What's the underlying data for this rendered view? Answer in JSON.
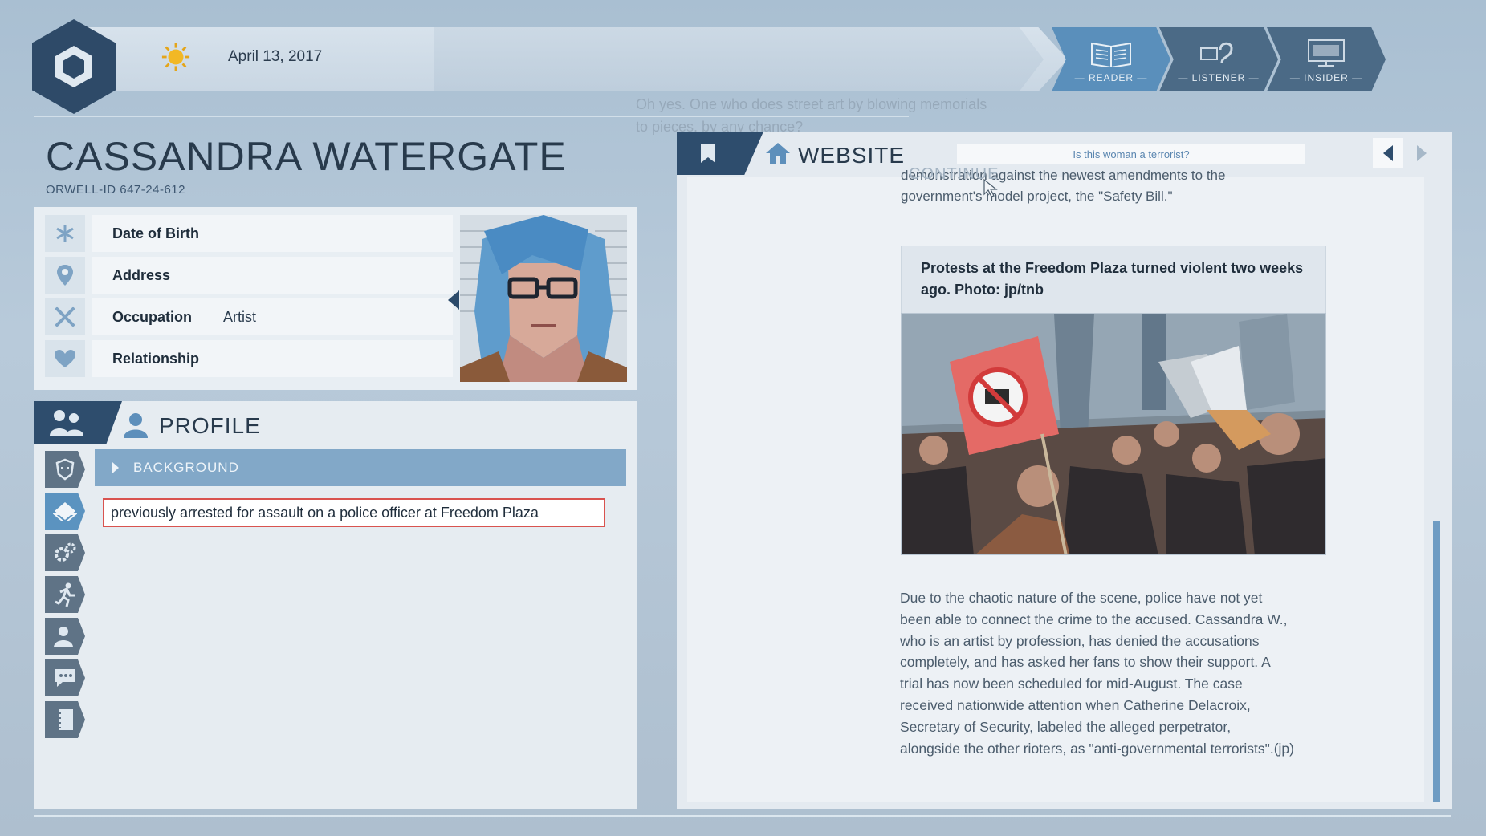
{
  "header": {
    "date": "April 13, 2017",
    "ghost_subtitle_line1": "Oh yes. One who does street art by blowing memorials",
    "ghost_subtitle_line2": "to pieces, by any chance?",
    "modes": [
      {
        "label": "— READER —",
        "icon": "book-icon",
        "active": true
      },
      {
        "label": "— LISTENER —",
        "icon": "ear-icon",
        "active": false
      },
      {
        "label": "— INSIDER —",
        "icon": "monitor-icon",
        "active": false
      }
    ]
  },
  "person": {
    "name": "CASSANDRA WATERGATE",
    "orwell_id": "ORWELL-ID  647-24-612",
    "fields": [
      {
        "label": "Date of Birth",
        "value": "",
        "icon": "asterisk-icon"
      },
      {
        "label": "Address",
        "value": "",
        "icon": "location-pin-icon"
      },
      {
        "label": "Occupation",
        "value": "Artist",
        "icon": "tools-icon"
      },
      {
        "label": "Relationship",
        "value": "",
        "icon": "heart-icon"
      }
    ]
  },
  "profile": {
    "title": "PROFILE",
    "section": "BACKGROUND",
    "fact": "previously arrested for assault on a police officer at Freedom Plaza",
    "side_icons": [
      "face-icon",
      "tag-icon",
      "gears-icon",
      "runner-icon",
      "person-icon",
      "chat-icon",
      "notebook-icon"
    ]
  },
  "website": {
    "title": "WEBSITE",
    "search_text": "Is this woman a terrorist?",
    "ghost_continue": "CONTINUE",
    "intro_line1": "demonstration against the newest amendments to the",
    "intro_line2": "government's model project, the \"Safety Bill.\"",
    "caption": "Protests at the Freedom Plaza turned violent two weeks ago. Photo: jp/tnb",
    "body_lines": [
      "Due to the chaotic nature of the scene, police have not yet",
      "been able to connect the crime to the accused. Cassandra W.,",
      "who is an artist by profession, has denied the accusations",
      "completely, and has asked her fans to show their support. A",
      "trial has now been scheduled for mid-August. The case",
      "received nationwide attention when Catherine Delacroix,",
      "Secretary of Security, labeled the alleged perpetrator,",
      "alongside the other rioters, as \"anti-governmental terrorists\".(jp)"
    ]
  }
}
